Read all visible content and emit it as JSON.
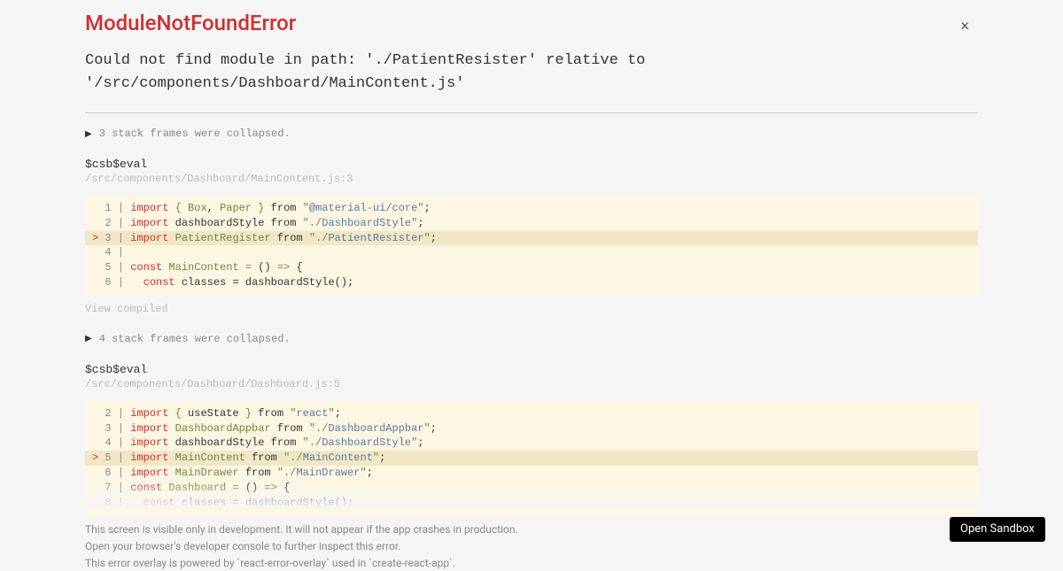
{
  "error": {
    "title": "ModuleNotFoundError",
    "message_l1": "Could not find module in path: './PatientResister' relative to",
    "message_l2": "'/src/components/Dashboard/MainContent.js'"
  },
  "collapsed1": "3 stack frames were collapsed.",
  "frame1": {
    "label": "$csb$eval",
    "path": "/src/components/Dashboard/MainContent.js:3"
  },
  "view_compiled": "View compiled",
  "collapsed2": "4 stack frames were collapsed.",
  "frame2": {
    "label": "$csb$eval",
    "path": "/src/components/Dashboard/Dashboard.js:5"
  },
  "footer": {
    "l1": "This screen is visible only in development. It will not appear if the app crashes in production.",
    "l2": "Open your browser's developer console to further inspect this error.",
    "l3": "This error overlay is powered by `react-error-overlay` used in `create-react-app`."
  },
  "open_sandbox": "Open Sandbox",
  "code1": {
    "l1": {
      "num": "1",
      "kw": "import",
      "lb": "{ ",
      "id1": "Box",
      "comma": ", ",
      "id2": "Paper",
      "rb": " }",
      "from": " from ",
      "q1": "\"",
      "path": "@material-ui/core",
      "q2": "\"",
      "semi": ";"
    },
    "l2": {
      "num": "2",
      "kw": "import",
      "id": " dashboardStyle ",
      "from": "from ",
      "q1": "\"./",
      "path": "DashboardStyle",
      "q2": "\"",
      "semi": ";"
    },
    "l3": {
      "marker": "> ",
      "num": "3",
      "kw": "import",
      "id": " PatientRegister ",
      "from": "from ",
      "q1": "\"./",
      "path": "PatientResister",
      "q2": "\"",
      "semi": ";"
    },
    "l4": {
      "num": "4"
    },
    "l5": {
      "num": "5",
      "kw": "const",
      "id": " MainContent ",
      "eq": "= ",
      "paren": "() ",
      "arrow": "=>",
      "brace": " {"
    },
    "l6": {
      "num": "6",
      "indent": "  ",
      "kw": "const",
      "rest": " classes = dashboardStyle();"
    }
  },
  "code2": {
    "l1": {
      "num": "2",
      "kw": "import",
      "lb": " { ",
      "id": "useState",
      "rb": " } ",
      "from": "from ",
      "q1": "\"",
      "path": "react",
      "q2": "\"",
      "semi": ";"
    },
    "l2": {
      "num": "3",
      "kw": "import",
      "id": " DashboardAppbar ",
      "from": "from ",
      "q1": "\"./",
      "path": "DashboardAppbar",
      "q2": "\"",
      "semi": ";"
    },
    "l3": {
      "num": "4",
      "kw": "import",
      "id": " dashboardStyle ",
      "from": "from ",
      "q1": "\"./",
      "path": "DashboardStyle",
      "q2": "\"",
      "semi": ";"
    },
    "l4": {
      "marker": "> ",
      "num": "5",
      "kw": "import",
      "id": " MainContent ",
      "from": "from ",
      "q1": "\"./",
      "path": "MainContent",
      "q2": "\"",
      "semi": ";"
    },
    "l5": {
      "num": "6",
      "kw": "import",
      "id": " MainDrawer ",
      "from": "from ",
      "q1": "\"./",
      "path": "MainDrawer",
      "q2": "\"",
      "semi": ";"
    },
    "l6": {
      "num": "7",
      "kw": "const",
      "id": " Dashboard ",
      "eq": "= ",
      "paren": "() ",
      "arrow": "=>",
      "brace": " {"
    },
    "l7": {
      "num": "8",
      "indent": "  ",
      "kw": "const",
      "rest": " classes = dashboardStyle();"
    }
  }
}
